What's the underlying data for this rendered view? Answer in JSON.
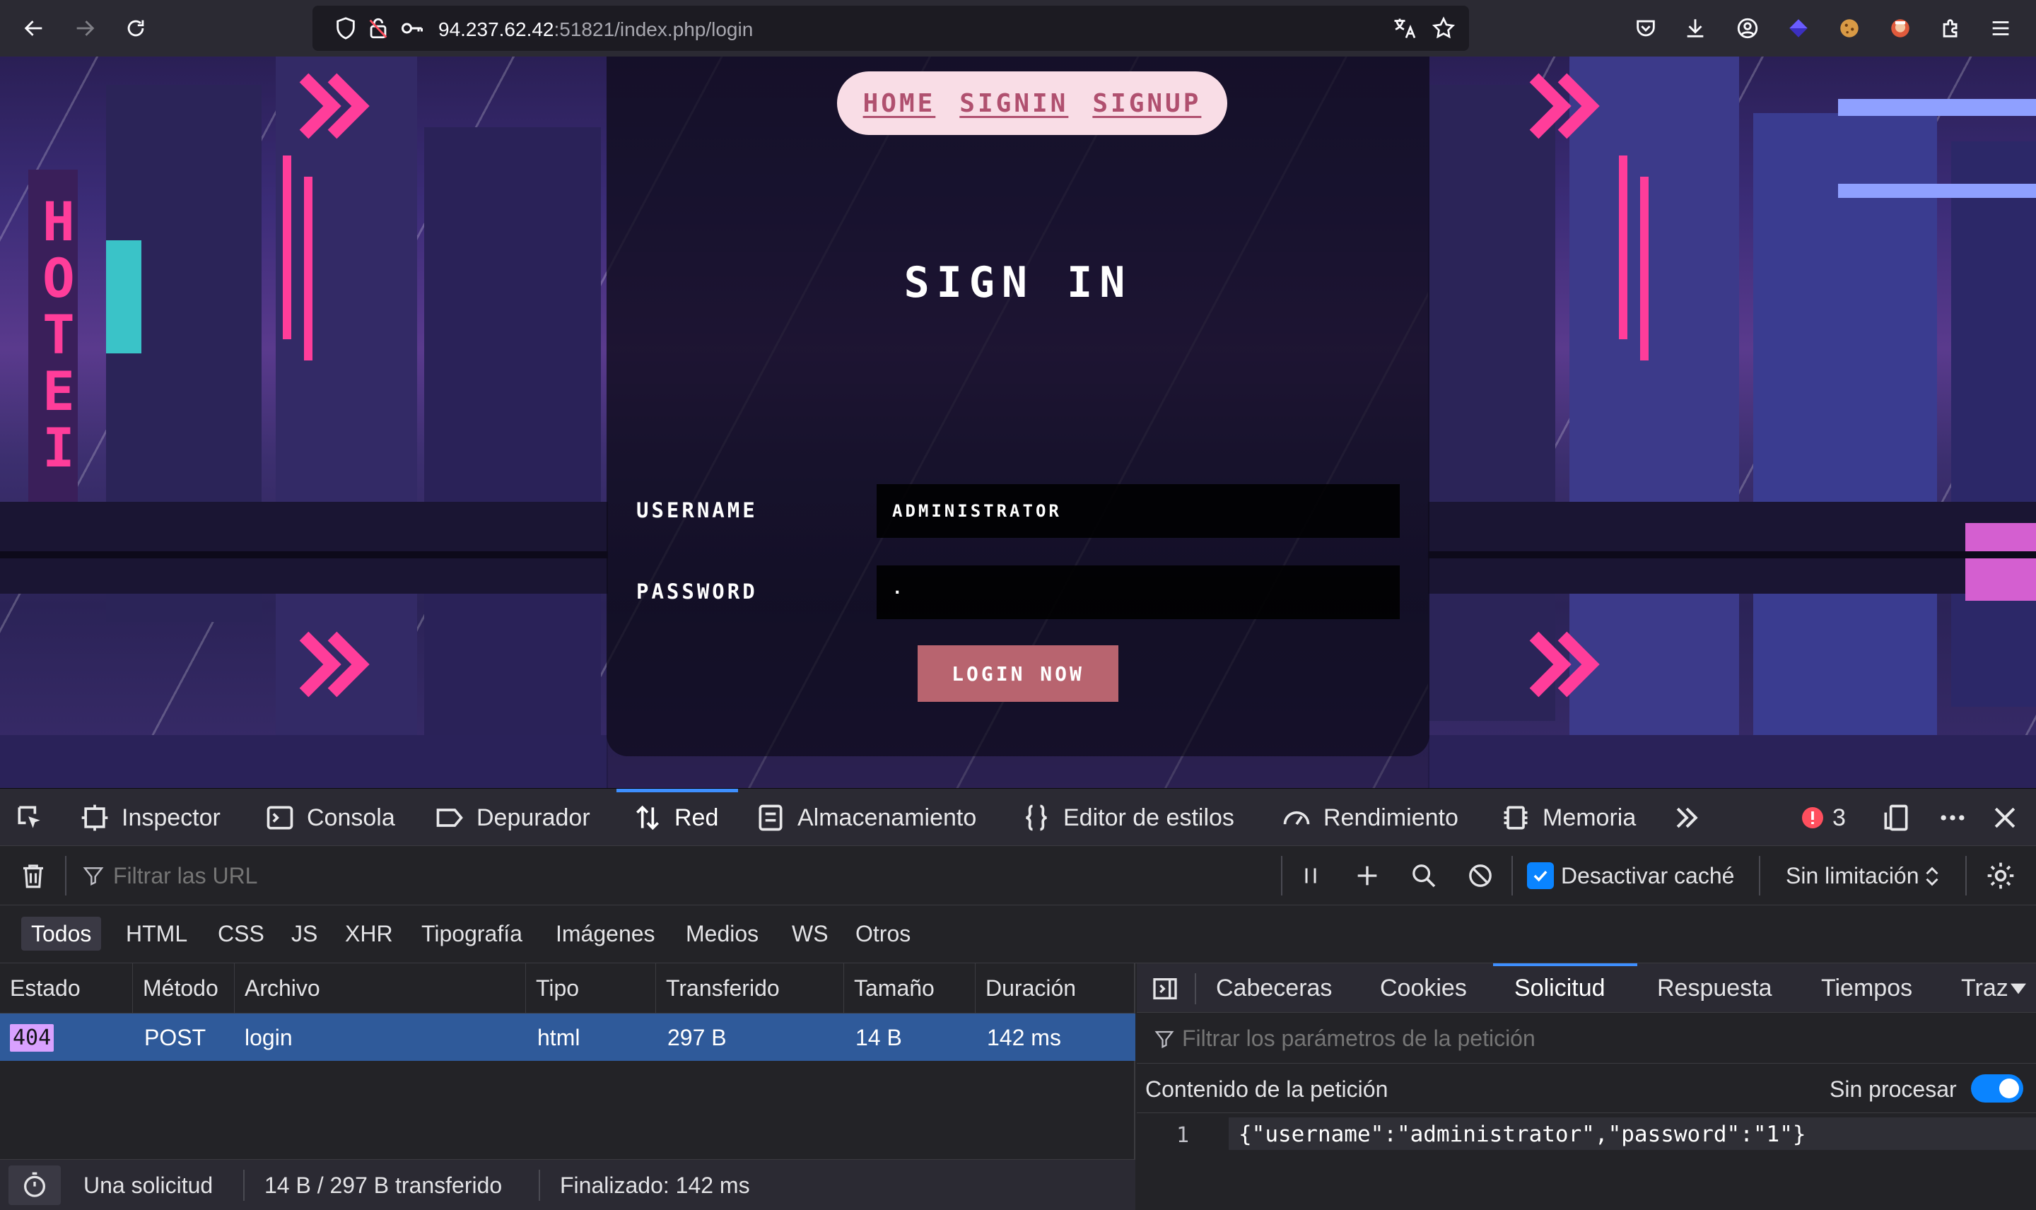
{
  "browser": {
    "url_host": "94.237.62.42",
    "url_rest": ":51821/index.php/login"
  },
  "page": {
    "nav": {
      "home": "HOME",
      "signin": "SIGNIN",
      "signup": "SIGNUP"
    },
    "title": "SIGN IN",
    "username_label": "USERNAME",
    "username_value": "ADMINISTRATOR",
    "password_label": "PASSWORD",
    "password_value": "·",
    "login_button": "LOGIN NOW"
  },
  "devtools": {
    "tabs": [
      "Inspector",
      "Consola",
      "Depurador",
      "Red",
      "Almacenamiento",
      "Editor de estilos",
      "Rendimiento",
      "Memoria"
    ],
    "active_tab": "Red",
    "error_count": "3",
    "filter_placeholder": "Filtrar las URL",
    "disable_cache_label": "Desactivar caché",
    "throttling": "Sin limitación",
    "type_filters": [
      "Todos",
      "HTML",
      "CSS",
      "JS",
      "XHR",
      "Tipografía",
      "Imágenes",
      "Medios",
      "WS",
      "Otros"
    ],
    "columns": [
      "Estado",
      "Método",
      "Archivo",
      "Tipo",
      "Transferido",
      "Tamaño",
      "Duración"
    ],
    "request": {
      "status": "404",
      "method": "POST",
      "file": "login",
      "type": "html",
      "transferred": "297 B",
      "size": "14 B",
      "duration": "142 ms"
    },
    "status_bar": {
      "requests": "Una solicitud",
      "transferred": "14 B / 297 B transferido",
      "finished": "Finalizado: 142 ms"
    },
    "side_tabs": [
      "Cabeceras",
      "Cookies",
      "Solicitud",
      "Respuesta",
      "Tiempos",
      "Traz"
    ],
    "side_active": "Solicitud",
    "param_filter_placeholder": "Filtrar los parámetros de la petición",
    "request_content_label": "Contenido de la petición",
    "raw_label": "Sin procesar",
    "code_line_number": "1",
    "code_line": "{\"username\":\"administrator\",\"password\":\"1\"}"
  },
  "colors": {
    "accent": "#3e8fff",
    "row_selected": "#2f5a9a",
    "status_404": "#d9a1ff",
    "login_button": "#b8646f",
    "nav_pill": "#f9dde6"
  }
}
